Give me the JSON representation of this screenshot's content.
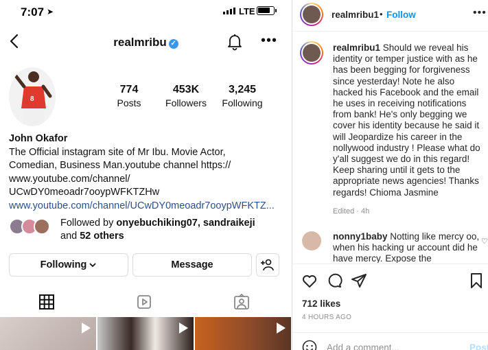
{
  "status_bar": {
    "time": "7:07",
    "network": "LTE"
  },
  "profile": {
    "username": "realmribu",
    "stats": [
      {
        "value": "774",
        "label": "Posts"
      },
      {
        "value": "453K",
        "label": "Followers"
      },
      {
        "value": "3,245",
        "label": "Following"
      }
    ],
    "name": "John Okafor",
    "bio_lines": [
      "The Official instagram site of Mr Ibu. Movie Actor,",
      "Comedian, Business Man.youtube channel https://",
      "www.youtube.com/channel/",
      "UCwDY0meoadr7ooypWFKTZHw"
    ],
    "link": "www.youtube.com/channel/UCwDY0meoadr7ooypWFKTZ...",
    "followed_by": {
      "prefix": "Followed by ",
      "names": "onyebuchiking07, sandraikeji",
      "middle": "and ",
      "others": "52 others"
    },
    "buttons": {
      "following": "Following",
      "message": "Message"
    }
  },
  "post": {
    "username": "realmribu1",
    "dot": "•",
    "follow": "Follow",
    "caption": "Should we reveal his identity or temper justice with as he has been begging for forgiveness since yesterday! Note he also hacked his Facebook and the email he uses in receiving notifications from bank! He's only begging we cover his identity because he said it will Jeopardize his career in the nollywood industry ! Please what do y'all suggest we do in this regard! Keep sharing until it gets to the appropriate news agencies! Thanks regards! Chioma Jasmine",
    "edited": "Edited · 4h",
    "comment": {
      "username": "nonny1baby",
      "text": "Notting like mercy oo, when his hacking ur account did he have mercy. Expose the"
    },
    "likes": "712 likes",
    "time_ago": "4 HOURS AGO",
    "add_comment_placeholder": "Add a comment...",
    "post_button": "Post"
  },
  "colors": {
    "accent": "#0095f6",
    "verified": "#3897f0",
    "link": "#2e4f86",
    "muted": "#8e8e8e"
  }
}
